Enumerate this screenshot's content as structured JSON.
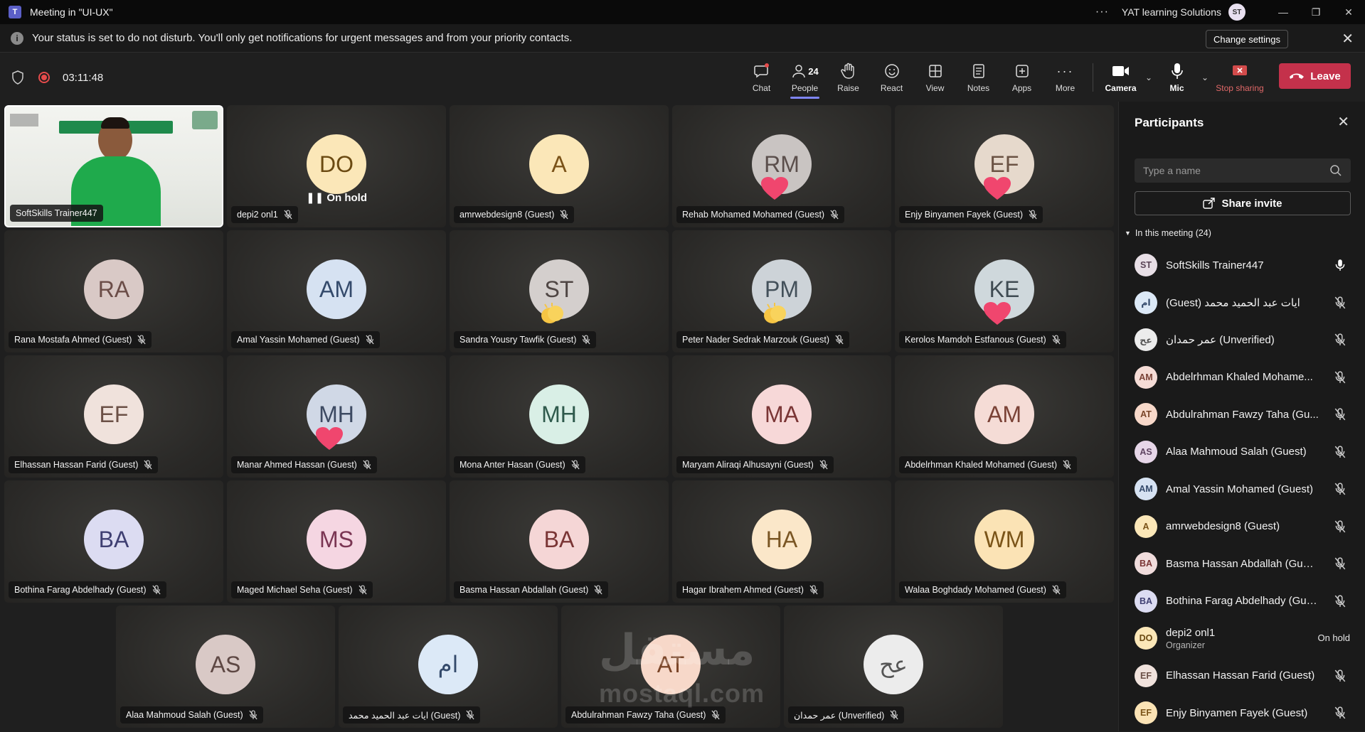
{
  "window": {
    "title": "Meeting in \"UI-UX\"",
    "org": "YAT learning Solutions",
    "user_initials": "ST"
  },
  "notification": {
    "message": "Your status is set to do not disturb. You'll only get notifications for urgent messages and from your priority contacts.",
    "change_settings": "Change settings"
  },
  "toolbar": {
    "timer": "03:11:48",
    "chat": "Chat",
    "people": "People",
    "people_count": "24",
    "raise": "Raise",
    "react": "React",
    "view": "View",
    "notes": "Notes",
    "apps": "Apps",
    "more": "More",
    "camera": "Camera",
    "mic": "Mic",
    "stop_sharing": "Stop sharing",
    "leave": "Leave"
  },
  "tiles": [
    {
      "name": "SoftSkills Trainer447",
      "initials": "",
      "video": true
    },
    {
      "name": "depi2 onl1",
      "initials": "DO",
      "bg": "#fbe7b8",
      "fg": "#6b4a12",
      "onhold": "On hold"
    },
    {
      "name": "amrwebdesign8 (Guest)",
      "initials": "A",
      "bg": "#fbe7b8",
      "fg": "#7a5218"
    },
    {
      "name": "Rehab Mohamed Mohamed (Guest)",
      "initials": "RM",
      "bg": "#c9c4c2",
      "fg": "#5b4f4c",
      "reaction": "heart"
    },
    {
      "name": "Enjy Binyamen Fayek (Guest)",
      "initials": "EF",
      "bg": "#e6d9cc",
      "fg": "#6b5344",
      "reaction": "heart"
    },
    {
      "name": "Rana Mostafa Ahmed (Guest)",
      "initials": "RA",
      "bg": "#d9c9c6",
      "fg": "#6b4d48"
    },
    {
      "name": "Amal Yassin Mohamed (Guest)",
      "initials": "AM",
      "bg": "#d6e2f2",
      "fg": "#344a6b"
    },
    {
      "name": "Sandra Yousry Tawfik (Guest)",
      "initials": "ST",
      "bg": "#d4cfcd",
      "fg": "#4f4644",
      "reaction": "clap"
    },
    {
      "name": "Peter Nader Sedrak Marzouk (Guest)",
      "initials": "PM",
      "bg": "#cdd3d8",
      "fg": "#43505a",
      "reaction": "clap"
    },
    {
      "name": "Kerolos Mamdoh Estfanous (Guest)",
      "initials": "KE",
      "bg": "#cfd8dc",
      "fg": "#3f4b52",
      "reaction": "heart"
    },
    {
      "name": "Elhassan Hassan Farid (Guest)",
      "initials": "EF",
      "bg": "#f0e2dc",
      "fg": "#6b5046"
    },
    {
      "name": "Manar Ahmed Hassan (Guest)",
      "initials": "MH",
      "bg": "#d0d8e6",
      "fg": "#3d4a62",
      "reaction": "heart"
    },
    {
      "name": "Mona Anter Hasan (Guest)",
      "initials": "MH",
      "bg": "#d9efe6",
      "fg": "#2f5a4c"
    },
    {
      "name": "Maryam Aliraqi Alhusayni (Guest)",
      "initials": "MA",
      "bg": "#f7d8d8",
      "fg": "#7a3535"
    },
    {
      "name": "Abdelrhman Khaled Mohamed (Guest)",
      "initials": "AM",
      "bg": "#f5dcd6",
      "fg": "#7a4236"
    },
    {
      "name": "Bothina Farag Abdelhady (Guest)",
      "initials": "BA",
      "bg": "#dcdcf2",
      "fg": "#3f3f72"
    },
    {
      "name": "Maged Michael Seha (Guest)",
      "initials": "MS",
      "bg": "#f5d6e2",
      "fg": "#7a3553"
    },
    {
      "name": "Basma Hassan Abdallah (Guest)",
      "initials": "BA",
      "bg": "#f5d6d6",
      "fg": "#7a3535"
    },
    {
      "name": "Hagar Ibrahem Ahmed (Guest)",
      "initials": "HA",
      "bg": "#fbe7c9",
      "fg": "#7a5624"
    },
    {
      "name": "Walaa Boghdady Mohamed (Guest)",
      "initials": "WM",
      "bg": "#fbe3b5",
      "fg": "#7a5418"
    },
    {
      "name": "Alaa Mahmoud Salah (Guest)",
      "initials": "AS",
      "bg": "#d9c9c6",
      "fg": "#5e4844"
    },
    {
      "name": "ايات عبد الحميد محمد (Guest)",
      "initials": "ام",
      "bg": "#dce9f7",
      "fg": "#344a6b"
    },
    {
      "name": "Abdulrahman Fawzy Taha (Guest)",
      "initials": "AT",
      "bg": "#f7d8c9",
      "fg": "#7a4528"
    },
    {
      "name": "عمر حمدان (Unverified)",
      "initials": "عح",
      "bg": "#ececec",
      "fg": "#555555"
    }
  ],
  "panel": {
    "title": "Participants",
    "search_placeholder": "Type a name",
    "share_invite": "Share invite",
    "section": "In this meeting (24)",
    "participants": [
      {
        "initials": "ST",
        "name": "SoftSkills Trainer447",
        "bg": "#e8dfe6",
        "fg": "#5a4456",
        "mic": "on"
      },
      {
        "initials": "ام",
        "name": "(Guest) ايات عبد الحميد محمد",
        "bg": "#dce9f7",
        "fg": "#344a6b",
        "mic": "off"
      },
      {
        "initials": "عح",
        "name": "عمر حمدان (Unverified)",
        "bg": "#ececec",
        "fg": "#555555",
        "mic": "off"
      },
      {
        "initials": "AM",
        "name": "Abdelrhman Khaled Mohame...",
        "bg": "#f5dcd6",
        "fg": "#7a4236",
        "mic": "off"
      },
      {
        "initials": "AT",
        "name": "Abdulrahman Fawzy Taha (Gu...",
        "bg": "#f7d8c9",
        "fg": "#7a4528",
        "mic": "off"
      },
      {
        "initials": "AS",
        "name": "Alaa Mahmoud Salah (Guest)",
        "bg": "#e6d6e8",
        "fg": "#5e4462",
        "mic": "off"
      },
      {
        "initials": "AM",
        "name": "Amal Yassin Mohamed (Guest)",
        "bg": "#d6e2f2",
        "fg": "#344a6b",
        "mic": "off"
      },
      {
        "initials": "A",
        "name": "amrwebdesign8 (Guest)",
        "bg": "#fbe7b8",
        "fg": "#7a5218",
        "mic": "off"
      },
      {
        "initials": "BA",
        "name": "Basma Hassan Abdallah (Guest)",
        "bg": "#f0dcdc",
        "fg": "#7a3535",
        "mic": "off"
      },
      {
        "initials": "BA",
        "name": "Bothina Farag Abdelhady (Gue...",
        "bg": "#dcdcf2",
        "fg": "#3f3f72",
        "mic": "off"
      },
      {
        "initials": "DO",
        "name": "depi2 onl1",
        "sub": "Organizer",
        "bg": "#fbe7b8",
        "fg": "#6b4a12",
        "status": "On hold"
      },
      {
        "initials": "EF",
        "name": "Elhassan Hassan Farid (Guest)",
        "bg": "#f0e2dc",
        "fg": "#6b5046",
        "mic": "off"
      },
      {
        "initials": "EF",
        "name": "Enjy Binyamen Fayek (Guest)",
        "bg": "#fbe3b5",
        "fg": "#7a5418",
        "mic": "off"
      }
    ]
  },
  "watermark": {
    "line1": "مستقل",
    "line2": "mostaql.com"
  }
}
